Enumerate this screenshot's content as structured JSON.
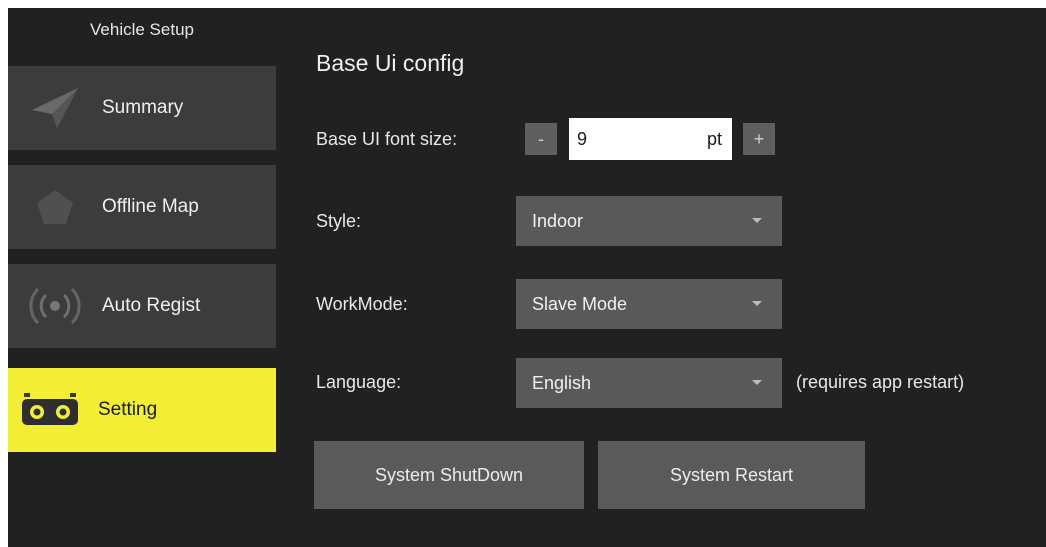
{
  "sidebar": {
    "title": "Vehicle Setup",
    "items": [
      {
        "label": "Summary",
        "icon": "paper-plane-icon"
      },
      {
        "label": "Offline Map",
        "icon": "map-pentagon-icon"
      },
      {
        "label": "Auto Regist",
        "icon": "broadcast-icon"
      },
      {
        "label": "Setting",
        "icon": "robot-face-icon",
        "active": true
      }
    ]
  },
  "main": {
    "section_title": "Base Ui config",
    "font_size": {
      "label": "Base UI font size:",
      "decrement": "-",
      "value": "9",
      "unit": "pt",
      "increment": "+"
    },
    "style": {
      "label": "Style:",
      "value": "Indoor"
    },
    "workmode": {
      "label": "WorkMode:",
      "value": "Slave Mode"
    },
    "language": {
      "label": "Language:",
      "value": "English",
      "note": "(requires app restart)"
    },
    "buttons": {
      "shutdown": "System ShutDown",
      "restart": "System Restart"
    }
  },
  "colors": {
    "background": "#212121",
    "sidebar_button": "#3c3c3c",
    "active_accent": "#f2ee34",
    "control": "#595959"
  }
}
